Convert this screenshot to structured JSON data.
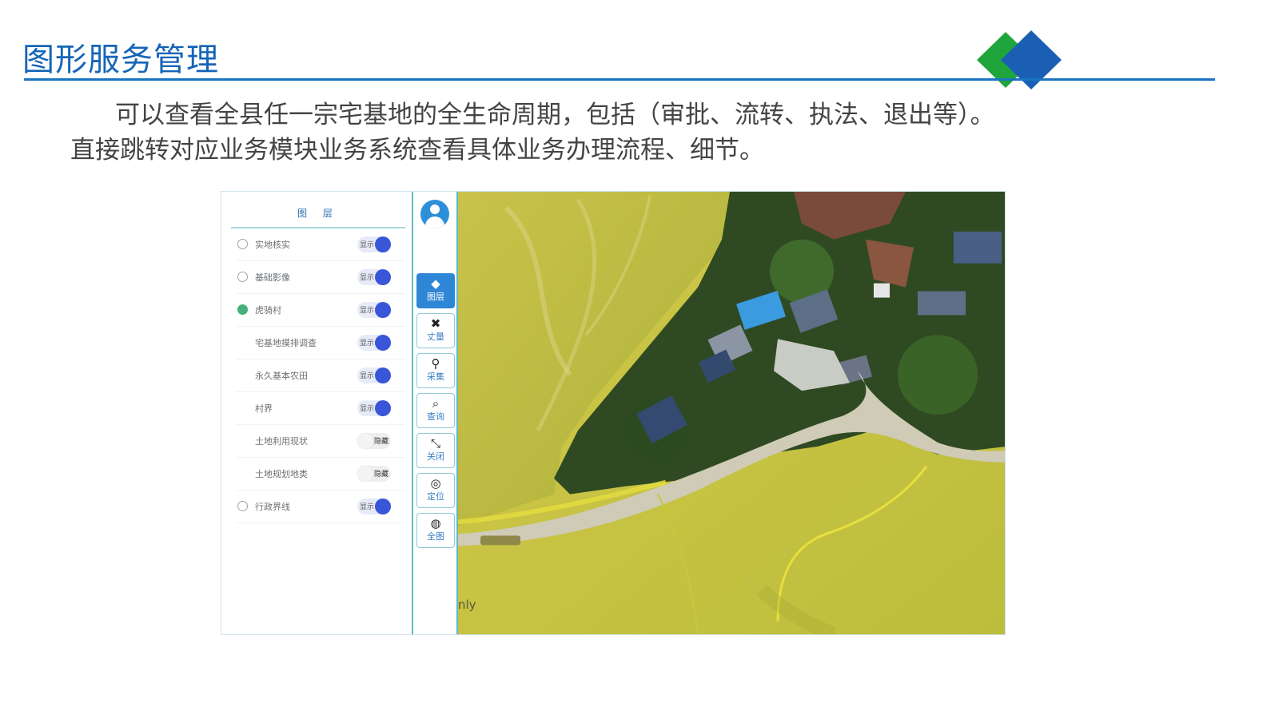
{
  "slide": {
    "title": "图形服务管理",
    "desc_line1": "可以查看全县任一宗宅基地的全生命周期，包括（审批、流转、执法、退出等）。",
    "desc_line2": "直接跳转对应业务模块业务系统查看具体业务办理流程、细节。"
  },
  "colors": {
    "accent": "#1565b7",
    "logo_green": "#1fa53c",
    "logo_blue": "#1a5fb4",
    "panel_border": "#5fb9c6",
    "toggle_on": "#3a56d8"
  },
  "layer_panel": {
    "title": "图 层",
    "layers": [
      {
        "name": "实地核实",
        "state": "显示"
      },
      {
        "name": "基础影像",
        "state": "显示"
      },
      {
        "name": "虎骑村",
        "state": "显示"
      },
      {
        "name": "宅基地摸排调查",
        "state": "显示"
      },
      {
        "name": "永久基本农田",
        "state": "显示"
      },
      {
        "name": "村界",
        "state": "显示"
      },
      {
        "name": "土地利用现状",
        "state": "隐藏"
      },
      {
        "name": "土地规划地类",
        "state": "隐藏"
      },
      {
        "name": "行政界线",
        "state": "显示"
      }
    ]
  },
  "toolbar": {
    "avatar_icon": "user-avatar-icon",
    "tools": [
      {
        "label": "图层",
        "icon": "layers-icon"
      },
      {
        "label": "丈量",
        "icon": "measure-icon"
      },
      {
        "label": "采集",
        "icon": "collect-icon"
      },
      {
        "label": "查询",
        "icon": "search-icon"
      },
      {
        "label": "关闭",
        "icon": "close-icon"
      },
      {
        "label": "定位",
        "icon": "locate-icon"
      },
      {
        "label": "全图",
        "icon": "globe-icon"
      }
    ]
  },
  "map": {
    "attribution": "nly"
  }
}
